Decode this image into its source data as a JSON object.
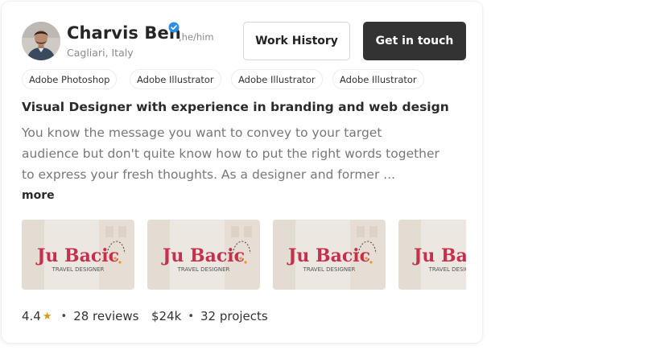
{
  "profile": {
    "name": "Charvis Ben",
    "pronouns": ",he/him",
    "location": "Cagliari, Italy",
    "verified_icon": "verified-badge-icon",
    "accent_color": "#2d8ee8"
  },
  "actions": {
    "work_history_label": "Work History",
    "get_in_touch_label": "Get in touch"
  },
  "skills": [
    {
      "label": "Adobe Photoshop"
    },
    {
      "label": "Adobe Illustrator"
    },
    {
      "label": "Adobe Illustrator"
    },
    {
      "label": "Adobe Illustrator"
    }
  ],
  "headline": "Visual Designer with experience in branding and web design",
  "description_lines": [
    "You know the message you want to convey to your target",
    "audience but don't quite know how to put the right words together",
    "to express your fresh thoughts. As a designer and former ..."
  ],
  "more_label": "more",
  "portfolio": [
    {
      "title": "Ju Bacic",
      "subtitle": "TRAVEL DESIGNER"
    },
    {
      "title": "Ju Bacic",
      "subtitle": "TRAVEL DESIGNER"
    },
    {
      "title": "Ju Bacic",
      "subtitle": "TRAVEL DESIGNER"
    },
    {
      "title": "Ju Bacic",
      "subtitle": "TRAVEL DESIGNER"
    }
  ],
  "stats": {
    "rating": "4.4",
    "star_icon": "star-icon",
    "star_color": "#d39b1a",
    "reviews": "28 reviews",
    "rate": "$24k",
    "projects": "32 projects",
    "separator": "•"
  }
}
